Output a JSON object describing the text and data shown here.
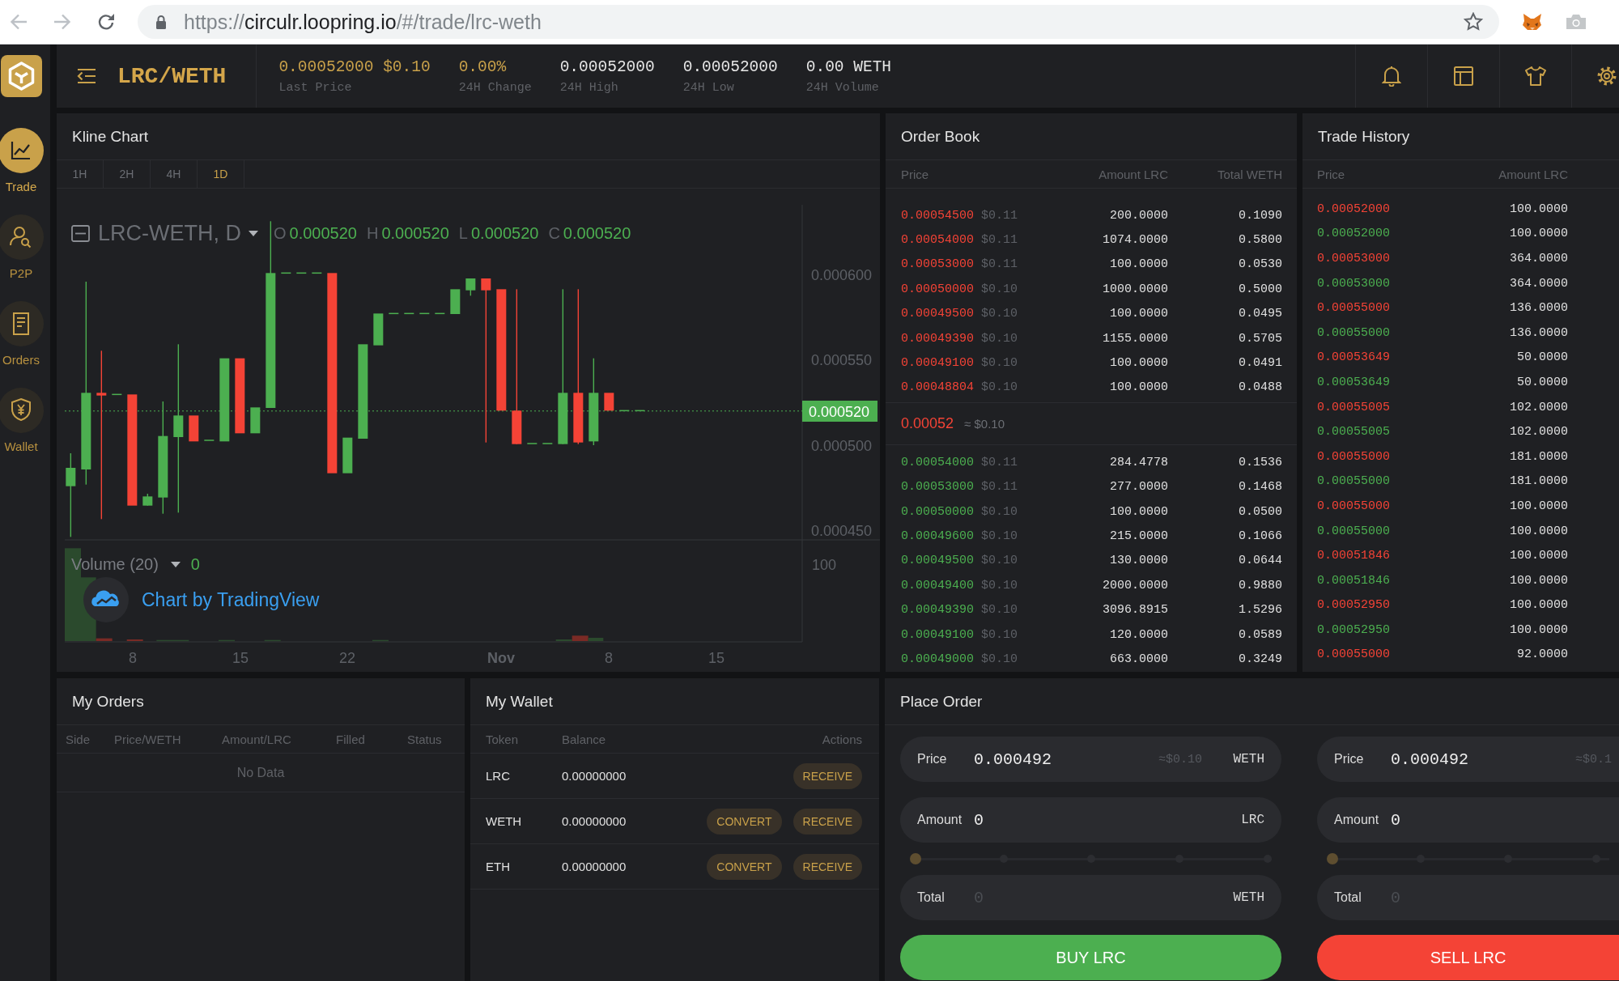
{
  "browser": {
    "url": {
      "scheme": "https://",
      "host": "circulr.loopring.io",
      "path": "/#/trade/lrc-weth"
    }
  },
  "sidebar": {
    "items": [
      {
        "label": "Trade",
        "selected": true
      },
      {
        "label": "P2P",
        "selected": false
      },
      {
        "label": "Orders",
        "selected": false
      },
      {
        "label": "Wallet",
        "selected": false
      }
    ]
  },
  "header": {
    "pair": "LRC/WETH",
    "stats": [
      {
        "value": "0.00052000 $0.10",
        "label": "Last Price",
        "kind": "accent"
      },
      {
        "value": "0.00%",
        "label": "24H Change",
        "kind": "accent"
      },
      {
        "value": "0.00052000",
        "label": "24H High",
        "kind": "plain"
      },
      {
        "value": "0.00052000",
        "label": "24H Low",
        "kind": "plain"
      },
      {
        "value": "0.00 WETH",
        "label": "24H Volume",
        "kind": "plain"
      }
    ]
  },
  "kline_chart": {
    "title": "Kline Chart",
    "intervals": [
      {
        "label": "1H",
        "selected": false
      },
      {
        "label": "2H",
        "selected": false
      },
      {
        "label": "4H",
        "selected": false
      },
      {
        "label": "1D",
        "selected": true
      }
    ],
    "legend": {
      "symbol": "LRC-WETH, D",
      "ohlc": [
        {
          "key": "O",
          "value": "0.000520"
        },
        {
          "key": "H",
          "value": "0.000520"
        },
        {
          "key": "L",
          "value": "0.000520"
        },
        {
          "key": "C",
          "value": "0.000520"
        }
      ]
    },
    "price_axis": [
      "0.000600",
      "0.000550",
      "0.000500",
      "0.000450"
    ],
    "last_price": "0.000520",
    "volume_legend": {
      "label": "Volume (20)",
      "value": "0"
    },
    "volume_axis": "100",
    "time_axis": [
      {
        "label": "8",
        "kind": "day"
      },
      {
        "label": "15",
        "kind": "day"
      },
      {
        "label": "22",
        "kind": "day"
      },
      {
        "label": "Nov",
        "kind": "month"
      },
      {
        "label": "8",
        "kind": "day"
      },
      {
        "label": "15",
        "kind": "day"
      }
    ],
    "attribution": "Chart by TradingView"
  },
  "order_book": {
    "title": "Order Book",
    "columns": [
      "Price",
      "Amount LRC",
      "Total WETH"
    ],
    "asks": [
      {
        "price": "0.00054500",
        "usd": "$0.11",
        "amount": "200.0000",
        "total": "0.1090"
      },
      {
        "price": "0.00054000",
        "usd": "$0.11",
        "amount": "1074.0000",
        "total": "0.5800"
      },
      {
        "price": "0.00053000",
        "usd": "$0.11",
        "amount": "100.0000",
        "total": "0.0530"
      },
      {
        "price": "0.00050000",
        "usd": "$0.10",
        "amount": "1000.0000",
        "total": "0.5000"
      },
      {
        "price": "0.00049500",
        "usd": "$0.10",
        "amount": "100.0000",
        "total": "0.0495"
      },
      {
        "price": "0.00049390",
        "usd": "$0.10",
        "amount": "1155.0000",
        "total": "0.5705"
      },
      {
        "price": "0.00049100",
        "usd": "$0.10",
        "amount": "100.0000",
        "total": "0.0491"
      },
      {
        "price": "0.00048804",
        "usd": "$0.10",
        "amount": "100.0000",
        "total": "0.0488"
      }
    ],
    "mid": {
      "price": "0.00052",
      "usd": "≈ $0.10"
    },
    "bids": [
      {
        "price": "0.00054000",
        "usd": "$0.11",
        "amount": "284.4778",
        "total": "0.1536"
      },
      {
        "price": "0.00053000",
        "usd": "$0.11",
        "amount": "277.0000",
        "total": "0.1468"
      },
      {
        "price": "0.00050000",
        "usd": "$0.10",
        "amount": "100.0000",
        "total": "0.0500"
      },
      {
        "price": "0.00049600",
        "usd": "$0.10",
        "amount": "215.0000",
        "total": "0.1066"
      },
      {
        "price": "0.00049500",
        "usd": "$0.10",
        "amount": "130.0000",
        "total": "0.0644"
      },
      {
        "price": "0.00049400",
        "usd": "$0.10",
        "amount": "2000.0000",
        "total": "0.9880"
      },
      {
        "price": "0.00049390",
        "usd": "$0.10",
        "amount": "3096.8915",
        "total": "1.5296"
      },
      {
        "price": "0.00049100",
        "usd": "$0.10",
        "amount": "120.0000",
        "total": "0.0589"
      },
      {
        "price": "0.00049000",
        "usd": "$0.10",
        "amount": "663.0000",
        "total": "0.3249"
      }
    ]
  },
  "trade_history": {
    "title": "Trade History",
    "columns": [
      "Price",
      "Amount LRC"
    ],
    "rows": [
      {
        "price": "0.00052000",
        "amount": "100.0000",
        "color": "#f44336"
      },
      {
        "price": "0.00052000",
        "amount": "100.0000",
        "color": "#4caf50"
      },
      {
        "price": "0.00053000",
        "amount": "364.0000",
        "color": "#f44336"
      },
      {
        "price": "0.00053000",
        "amount": "364.0000",
        "color": "#4caf50"
      },
      {
        "price": "0.00055000",
        "amount": "136.0000",
        "color": "#f44336"
      },
      {
        "price": "0.00055000",
        "amount": "136.0000",
        "color": "#4caf50"
      },
      {
        "price": "0.00053649",
        "amount": "50.0000",
        "color": "#f44336"
      },
      {
        "price": "0.00053649",
        "amount": "50.0000",
        "color": "#4caf50"
      },
      {
        "price": "0.00055005",
        "amount": "102.0000",
        "color": "#f44336"
      },
      {
        "price": "0.00055005",
        "amount": "102.0000",
        "color": "#4caf50"
      },
      {
        "price": "0.00055000",
        "amount": "181.0000",
        "color": "#f44336"
      },
      {
        "price": "0.00055000",
        "amount": "181.0000",
        "color": "#4caf50"
      },
      {
        "price": "0.00055000",
        "amount": "100.0000",
        "color": "#f44336"
      },
      {
        "price": "0.00055000",
        "amount": "100.0000",
        "color": "#4caf50"
      },
      {
        "price": "0.00051846",
        "amount": "100.0000",
        "color": "#f44336"
      },
      {
        "price": "0.00051846",
        "amount": "100.0000",
        "color": "#4caf50"
      },
      {
        "price": "0.00052950",
        "amount": "100.0000",
        "color": "#f44336"
      },
      {
        "price": "0.00052950",
        "amount": "100.0000",
        "color": "#4caf50"
      },
      {
        "price": "0.00055000",
        "amount": "92.0000",
        "color": "#f44336"
      }
    ]
  },
  "my_orders": {
    "title": "My Orders",
    "columns": [
      "Side",
      "Price/WETH",
      "Amount/LRC",
      "Filled",
      "Status"
    ],
    "empty": "No Data"
  },
  "my_wallet": {
    "title": "My Wallet",
    "columns": [
      "Token",
      "Balance",
      "Actions"
    ],
    "rows": [
      {
        "token": "LRC",
        "balance": "0.00000000",
        "actions": [
          "RECEIVE"
        ]
      },
      {
        "token": "WETH",
        "balance": "0.00000000",
        "actions": [
          "CONVERT",
          "RECEIVE"
        ]
      },
      {
        "token": "ETH",
        "balance": "0.00000000",
        "actions": [
          "CONVERT",
          "RECEIVE"
        ]
      }
    ]
  },
  "place_order": {
    "title": "Place Order",
    "forms": [
      {
        "kind": "buy",
        "price": {
          "label": "Price",
          "value": "0.000492",
          "hint": "≈$0.10",
          "unit": "WETH"
        },
        "amount": {
          "label": "Amount",
          "value": "0",
          "unit": "LRC"
        },
        "slider": {
          "level": 0
        },
        "total": {
          "label": "Total",
          "placeholder": "0",
          "unit": "WETH"
        },
        "button": "BUY LRC"
      },
      {
        "kind": "sell",
        "price": {
          "label": "Price",
          "value": "0.000492",
          "hint": "≈$0.1"
        },
        "amount": {
          "label": "Amount",
          "value": "0"
        },
        "slider": {
          "level": 0
        },
        "total": {
          "label": "Total",
          "placeholder": "0"
        },
        "button": "SELL LRC"
      }
    ]
  }
}
